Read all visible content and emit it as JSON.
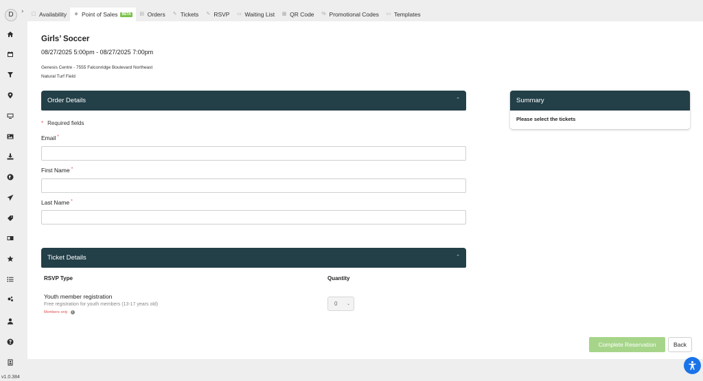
{
  "user": {
    "avatar_initial": "D"
  },
  "app": {
    "version": "v1.0.384"
  },
  "sidebar": {
    "icons": [
      "home-icon",
      "calendar-icon",
      "filter-icon",
      "map-pin-icon",
      "monitor-icon",
      "image-icon",
      "download-icon",
      "globe-icon",
      "send-icon",
      "tag-icon",
      "id-card-icon",
      "star-icon",
      "list-icon",
      "cogs-icon",
      "user-icon",
      "help-icon",
      "badge-icon"
    ]
  },
  "tabs": [
    {
      "label": "Availability",
      "icon": "calendar-icon"
    },
    {
      "label": "Point of Sales",
      "icon": "tag-icon",
      "badge": "BETA",
      "active": true
    },
    {
      "label": "Orders",
      "icon": "document-icon"
    },
    {
      "label": "Tickets",
      "icon": "edit-icon"
    },
    {
      "label": "RSVP",
      "icon": "edit-icon"
    },
    {
      "label": "Waiting List",
      "icon": "monitor-icon"
    },
    {
      "label": "QR Code",
      "icon": "qrcode-icon"
    },
    {
      "label": "Promotional Codes",
      "icon": "percent-icon"
    },
    {
      "label": "Templates",
      "icon": "template-icon"
    }
  ],
  "event": {
    "title": "Girls’ Soccer",
    "datetime": "08/27/2025 5:00pm - 08/27/2025 7:00pm",
    "venue": "Genesis Centre - 7555 Falconridge Boulevard Northeast",
    "field": "Natural Turf Field"
  },
  "order_details": {
    "heading": "Order Details",
    "required_note": "Required fields",
    "fields": {
      "email": {
        "label": "Email",
        "value": ""
      },
      "first_name": {
        "label": "First Name",
        "value": ""
      },
      "last_name": {
        "label": "Last Name",
        "value": ""
      }
    }
  },
  "ticket_details": {
    "heading": "Ticket Details",
    "col_type": "RSVP Type",
    "col_qty": "Quantity",
    "tickets": [
      {
        "name": "Youth member registration",
        "description": "Free registration for youth members (13-17 years old)",
        "restriction": "Members only",
        "quantity": "0"
      }
    ]
  },
  "summary": {
    "heading": "Summary",
    "body": "Please select the tickets"
  },
  "actions": {
    "complete": "Complete Reservation",
    "back": "Back"
  },
  "colors": {
    "header_bg": "#233f48",
    "complete_btn": "#a6d58a",
    "required_star": "#e05050",
    "beta_badge": "#7bc24d",
    "accessibility": "#1a73e8"
  }
}
